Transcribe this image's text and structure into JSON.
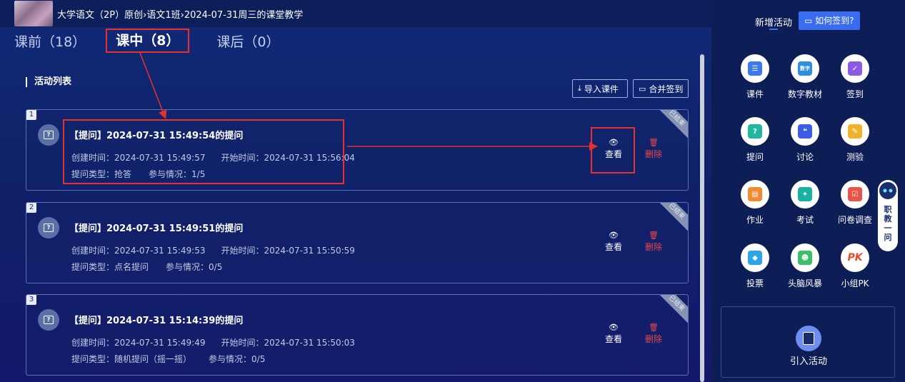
{
  "breadcrumb": {
    "course": "大学语文（2P）原创",
    "sep1": "›",
    "klass": "语文1班",
    "sep2": "›",
    "session": "2024-07-31周三的课堂教学"
  },
  "tabs": [
    {
      "label": "课前（18）"
    },
    {
      "label": "课中（8）",
      "active": true
    },
    {
      "label": "课后（0）"
    }
  ],
  "list_title": "活动列表",
  "toolbar": {
    "import_label": "导入课件",
    "merge_label": "合并签到",
    "import_icon": "download-icon",
    "merge_icon": "merge-icon"
  },
  "activities": [
    {
      "index": "1",
      "title": "【提问】2024-07-31 15:49:54的提问",
      "created_label": "创建时间：",
      "created": "2024-07-31 15:49:57",
      "started_label": "开始时间：",
      "started": "2024-07-31 15:56:04",
      "type_label": "提问类型：",
      "type": "抢答",
      "participation_label": "参与情况：",
      "participation": "1/5",
      "status": "已结束",
      "view_label": "查看",
      "delete_label": "删除"
    },
    {
      "index": "2",
      "title": "【提问】2024-07-31 15:49:51的提问",
      "created_label": "创建时间：",
      "created": "2024-07-31 15:49:53",
      "started_label": "开始时间：",
      "started": "2024-07-31 15:50:59",
      "type_label": "提问类型：",
      "type": "点名提问",
      "participation_label": "参与情况：",
      "participation": "0/5",
      "status": "已结束",
      "view_label": "查看",
      "delete_label": "删除"
    },
    {
      "index": "3",
      "title": "【提问】2024-07-31 15:14:39的提问",
      "created_label": "创建时间：",
      "created": "2024-07-31 15:49:49",
      "started_label": "开始时间：",
      "started": "2024-07-31 15:50:03",
      "type_label": "提问类型：",
      "type": "随机提问（摇一摇）",
      "participation_label": "参与情况：",
      "participation": "0/5",
      "status": "已结束",
      "view_label": "查看",
      "delete_label": "删除"
    }
  ],
  "sidebar": {
    "heading": "新增活动",
    "how_label": "如何签到?",
    "tools": [
      {
        "label": "课件",
        "icon": "courseware-icon",
        "color": "#3c78f0"
      },
      {
        "label": "数字教材",
        "icon": "digital-textbook-icon",
        "color": "#2e8fdc",
        "glyph": "数字"
      },
      {
        "label": "签到",
        "icon": "checkin-icon",
        "color": "#8a5ce6"
      },
      {
        "label": "提问",
        "icon": "question-icon",
        "color": "#1fb89e",
        "glyph": "?"
      },
      {
        "label": "讨论",
        "icon": "discussion-icon",
        "color": "#3a5ee8"
      },
      {
        "label": "测验",
        "icon": "quiz-icon",
        "color": "#f0b12c"
      },
      {
        "label": "作业",
        "icon": "homework-icon",
        "color": "#f08a35"
      },
      {
        "label": "考试",
        "icon": "exam-icon",
        "color": "#19b3a2"
      },
      {
        "label": "问卷调查",
        "icon": "survey-icon",
        "color": "#e8534a"
      },
      {
        "label": "投票",
        "icon": "vote-icon",
        "color": "#2aa6e8"
      },
      {
        "label": "头脑风暴",
        "icon": "brainstorm-icon",
        "color": "#3bbf6a"
      },
      {
        "label": "小组PK",
        "icon": "group-pk-icon",
        "color": "#e84a2e",
        "glyph": "PK"
      }
    ],
    "import_activity_label": "引入活动"
  },
  "assistant": {
    "text": "职教一问"
  }
}
